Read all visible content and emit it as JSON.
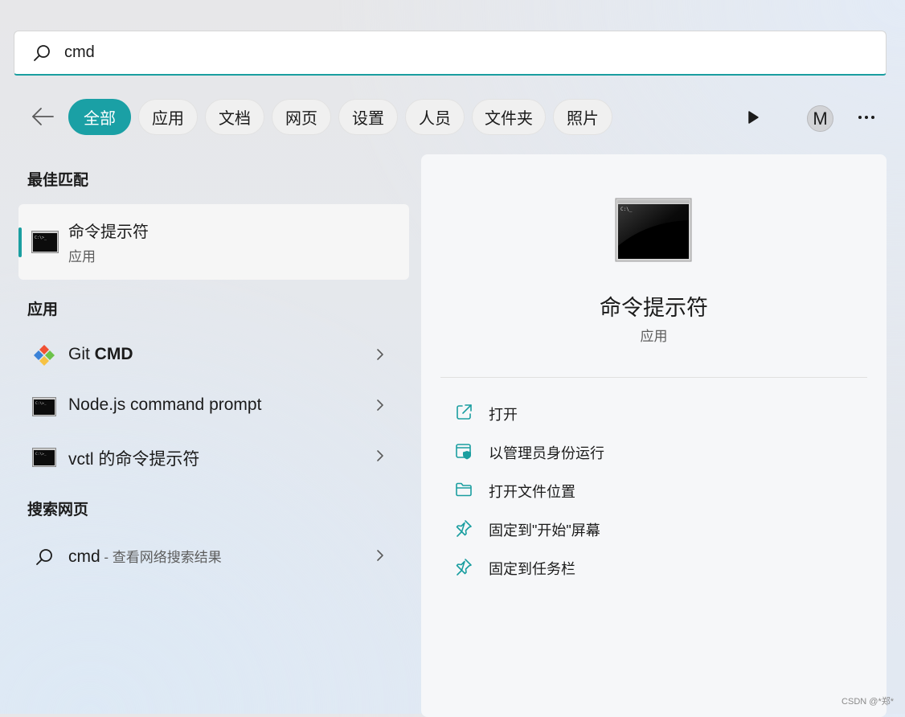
{
  "search": {
    "value": "cmd"
  },
  "filters": {
    "chips": [
      "全部",
      "应用",
      "文档",
      "网页",
      "设置",
      "人员",
      "文件夹",
      "照片"
    ],
    "active_index": 0,
    "avatar_letter": "M"
  },
  "best_match": {
    "title": "最佳匹配",
    "name": "命令提示符",
    "type": "应用"
  },
  "apps": {
    "title": "应用",
    "items": [
      {
        "name_prefix": "Git ",
        "name_bold": "CMD",
        "icon": "git-icon"
      },
      {
        "name": "Node.js command prompt",
        "icon": "console-icon"
      },
      {
        "name": "vctl 的命令提示符",
        "icon": "console-icon"
      }
    ]
  },
  "web": {
    "title": "搜索网页",
    "query": "cmd",
    "hint": " - 查看网络搜索结果"
  },
  "detail": {
    "name": "命令提示符",
    "type": "应用",
    "actions": [
      {
        "label": "打开",
        "icon": "open-external-icon"
      },
      {
        "label": "以管理员身份运行",
        "icon": "admin-shield-icon"
      },
      {
        "label": "打开文件位置",
        "icon": "folder-icon"
      },
      {
        "label": "固定到\"开始\"屏幕",
        "icon": "pin-icon"
      },
      {
        "label": "固定到任务栏",
        "icon": "pin-icon"
      }
    ]
  },
  "colors": {
    "accent": "#1a9ea0"
  },
  "watermark": "CSDN @*郑*"
}
